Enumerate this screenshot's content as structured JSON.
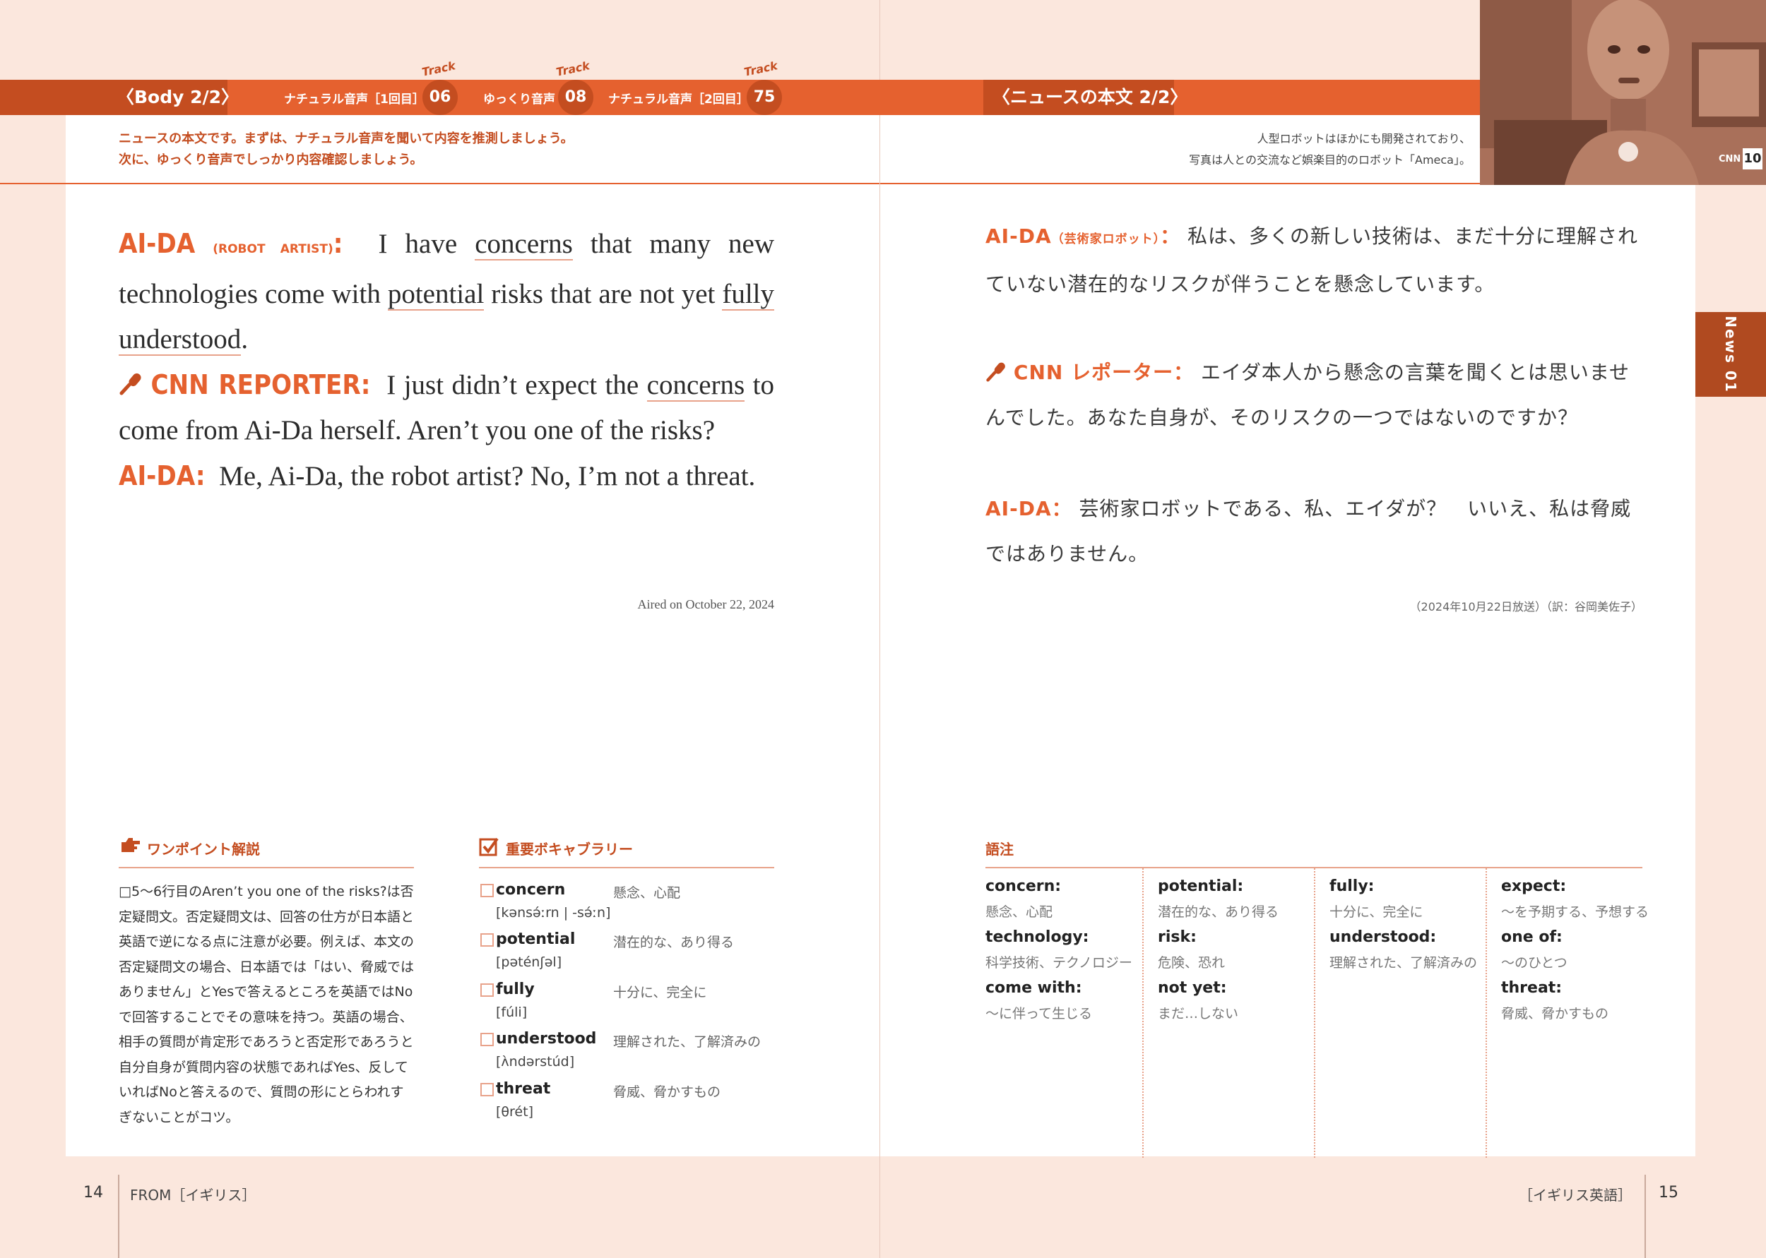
{
  "header": {
    "left_label": "〈Body 2/2〉",
    "right_label": "〈ニュースの本文 2/2〉",
    "tracks": [
      {
        "label": "ナチュラル音声［1回目］",
        "word": "Track",
        "number": "06"
      },
      {
        "label": "ゆっくり音声",
        "word": "Track",
        "number": "08"
      },
      {
        "label": "ナチュラル音声［2回目］",
        "word": "Track",
        "number": "75"
      }
    ],
    "intro_lines": [
      "ニュースの本文です。まずは、ナチュラル音声を聞いて内容を推測しましょう。",
      "次に、ゆっくり音声でしっかり内容確認しましょう。"
    ],
    "photo_caption_lines": [
      "人型ロボットはほかにも開発されており、",
      "写真は人との交流など娯楽目的のロボット「Ameca」。"
    ],
    "photo_badge": "10",
    "photo_logo": "CNN"
  },
  "english": {
    "aida_label": "AI-DA",
    "aida_sub": "(ROBOT ARTIST)",
    "colon": ":",
    "p1": {
      "t1": "I have ",
      "u1": "concerns",
      "t2": " that many new technologies come with ",
      "u2": "potential",
      "t3": " risks that are not yet ",
      "u3": "fully",
      "t4": " ",
      "u4": "understood",
      "t5": "."
    },
    "reporter_label": "CNN REPORTER:",
    "p2": {
      "t1": "I just didn’t expect the ",
      "u1": "concerns",
      "t2": " to come from Ai-Da herself. Aren’t you one of the risks?"
    },
    "aida2_label": "AI-DA:",
    "p3": "Me, Ai-Da, the robot artist? No, I’m not a threat.",
    "aired": "Aired on October 22, 2024"
  },
  "japanese": {
    "aida_label": "AI-DA",
    "aida_sub": "（芸術家ロボット）",
    "colon": "：",
    "p1": "私は、多くの新しい技術は、まだ十分に理解されていない潜在的なリスクが伴うことを懸念しています。",
    "reporter_label": "CNN レポーター：",
    "p2": "エイダ本人から懸念の言葉を聞くとは思いませんでした。あなた自身が、そのリスクの一つではないのですか？",
    "aida2_label": "AI-DA：",
    "p3": "芸術家ロボットである、私、エイダが？　いいえ、私は脅威ではありません。",
    "aired": "（2024年10月22日放送）（訳：谷岡美佐子）"
  },
  "side_tab": "News 01",
  "onepoint": {
    "title": "ワンポイント解説",
    "text": "□5～6行目のAren’t you one of the risks?は否定疑問文。否定疑問文は、回答の仕方が日本語と英語で逆になる点に注意が必要。例えば、本文の否定疑問文の場合、日本語では「はい、脅威ではありません」とYesで答えるところを英語ではNoで回答することでその意味を持つ。英語の場合、相手の質問が肯定形であろうと否定形であろうと自分自身が質問内容の状態であればYes、反していればNoと答えるので、質問の形にとらわれすぎないことがコツ。"
  },
  "vocabulary": {
    "title": "重要ボキャブラリー",
    "items": [
      {
        "word": "concern",
        "pron": "[kənsə́ːrn | -sə́ːn]",
        "meaning": "懸念、心配"
      },
      {
        "word": "potential",
        "pron": "[pəténʃəl]",
        "meaning": "潜在的な、あり得る"
      },
      {
        "word": "fully",
        "pron": "[fúli]",
        "meaning": "十分に、完全に"
      },
      {
        "word": "understood",
        "pron": "[ʌ̀ndərstúd]",
        "meaning": "理解された、了解済みの"
      },
      {
        "word": "threat",
        "pron": "[θrét]",
        "meaning": "脅威、脅かすもの"
      }
    ]
  },
  "glossary": {
    "title": "語注",
    "columns": [
      [
        {
          "term": "concern:",
          "def": "懸念、心配"
        },
        {
          "term": "technology:",
          "def": "科学技術、テクノロジー"
        },
        {
          "term": "come with:",
          "def": "～に伴って生じる"
        }
      ],
      [
        {
          "term": "potential:",
          "def": "潜在的な、あり得る"
        },
        {
          "term": "risk:",
          "def": "危険、恐れ"
        },
        {
          "term": "not yet:",
          "def": "まだ…しない"
        }
      ],
      [
        {
          "term": "fully:",
          "def": "十分に、完全に"
        },
        {
          "term": "understood:",
          "def": "理解された、了解済みの"
        }
      ],
      [
        {
          "term": "expect:",
          "def": "～を予期する、予想する"
        },
        {
          "term": "one of:",
          "def": "～のひとつ"
        },
        {
          "term": "threat:",
          "def": "脅威、脅かすもの"
        }
      ]
    ]
  },
  "footer": {
    "left_page": "14",
    "left_text": "FROM［イギリス］",
    "right_text": "［イギリス英語］",
    "right_page": "15"
  },
  "colors": {
    "accent": "#e5612f",
    "accent_dark": "#c44d20",
    "background": "#fbe7dd"
  }
}
